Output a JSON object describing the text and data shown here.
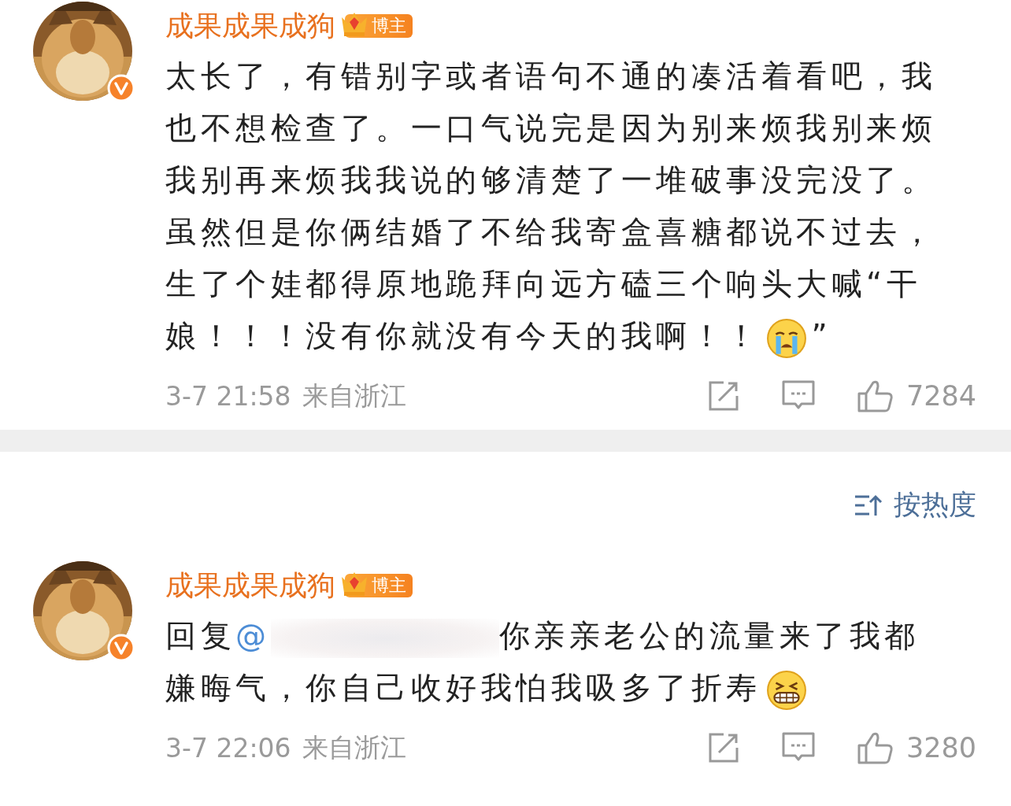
{
  "comments": [
    {
      "author": "成果成果成狗",
      "badge": "博主",
      "verified": true,
      "segments": [
        {
          "kind": "text",
          "text": "太长了，有错别字或者语句不通的凑活着看吧，我也不想检查了。一口气说完是因为别来烦我别来烦我别再来烦我我说的够清楚了一堆破事没完没了。虽然但是你俩结婚了不给我寄盒喜糖都说不过去，生了个娃都得原地跪拜向远方磕三个响头大喊“干娘！！！没有你就没有今天的我啊！！"
        },
        {
          "kind": "cry_emoji"
        },
        {
          "kind": "text",
          "text": "”"
        }
      ],
      "time": "3-7 21:58",
      "location": "来自浙江",
      "likes": "7284"
    },
    {
      "author": "成果成果成狗",
      "badge": "博主",
      "verified": true,
      "segments": [
        {
          "kind": "text",
          "text": "回复"
        },
        {
          "kind": "mention",
          "text": "@"
        },
        {
          "kind": "blur"
        },
        {
          "kind": "text",
          "text": "你亲亲老公的流量来了我都嫌晦气，你自己收好我怕我吸多了折寿"
        },
        {
          "kind": "grin_emoji"
        }
      ],
      "time": "3-7 22:06",
      "location": "来自浙江",
      "likes": "3280"
    }
  ],
  "sort": {
    "label": "按热度"
  }
}
